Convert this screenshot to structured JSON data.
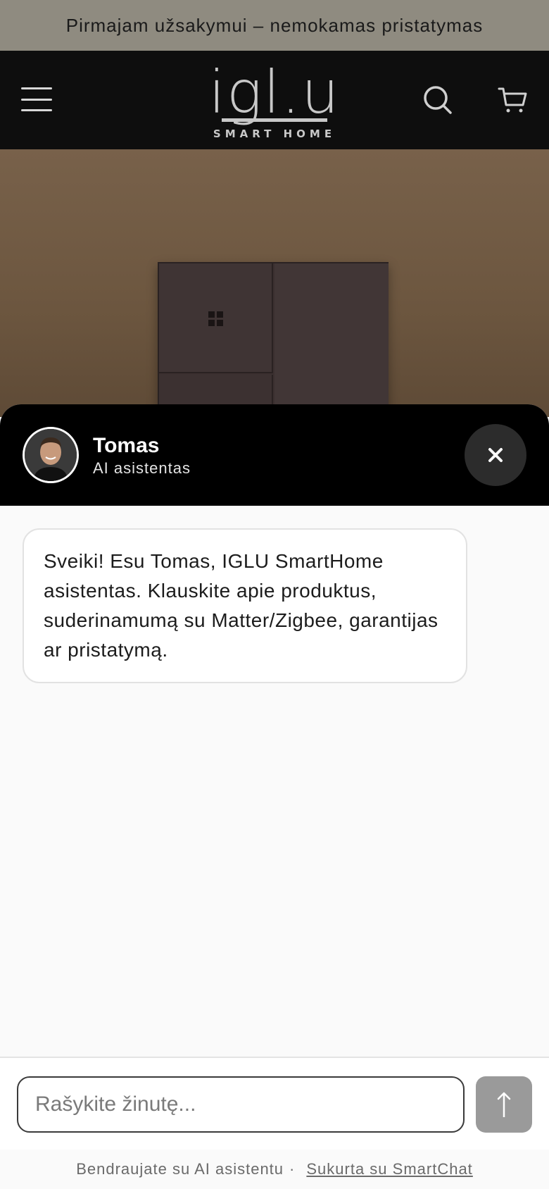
{
  "announcement": {
    "text": "Pirmajam užsakymui – nemokamas pristatymas"
  },
  "header": {
    "logo": {
      "word": "igl.u",
      "tagline": "SMART HOME"
    },
    "icons": {
      "menu": "hamburger-icon",
      "search": "search-icon",
      "cart": "cart-icon"
    }
  },
  "chat": {
    "agent": {
      "name": "Tomas",
      "role": "AI asistentas"
    },
    "close_icon": "close-icon",
    "messages": [
      {
        "from": "agent",
        "text": "Sveiki! Esu Tomas, IGLU SmartHome asistentas. Klauskite apie produktus, suderinamumą su Matter/Zigbee, garantijas ar pristatymą."
      }
    ],
    "input": {
      "placeholder": "Rašykite žinutę...",
      "value": ""
    },
    "send_icon": "arrow-up-icon",
    "footer": {
      "text": "Bendraujate su AI asistentu",
      "separator": "·",
      "link_text": "Sukurta su SmartChat"
    }
  },
  "colors": {
    "announcement_bg": "#8f8b80",
    "header_bg": "#0e0e0e",
    "chat_header_bg": "#000000",
    "close_button_bg": "#2c2c2c",
    "send_button_bg": "#9a9a9a"
  }
}
